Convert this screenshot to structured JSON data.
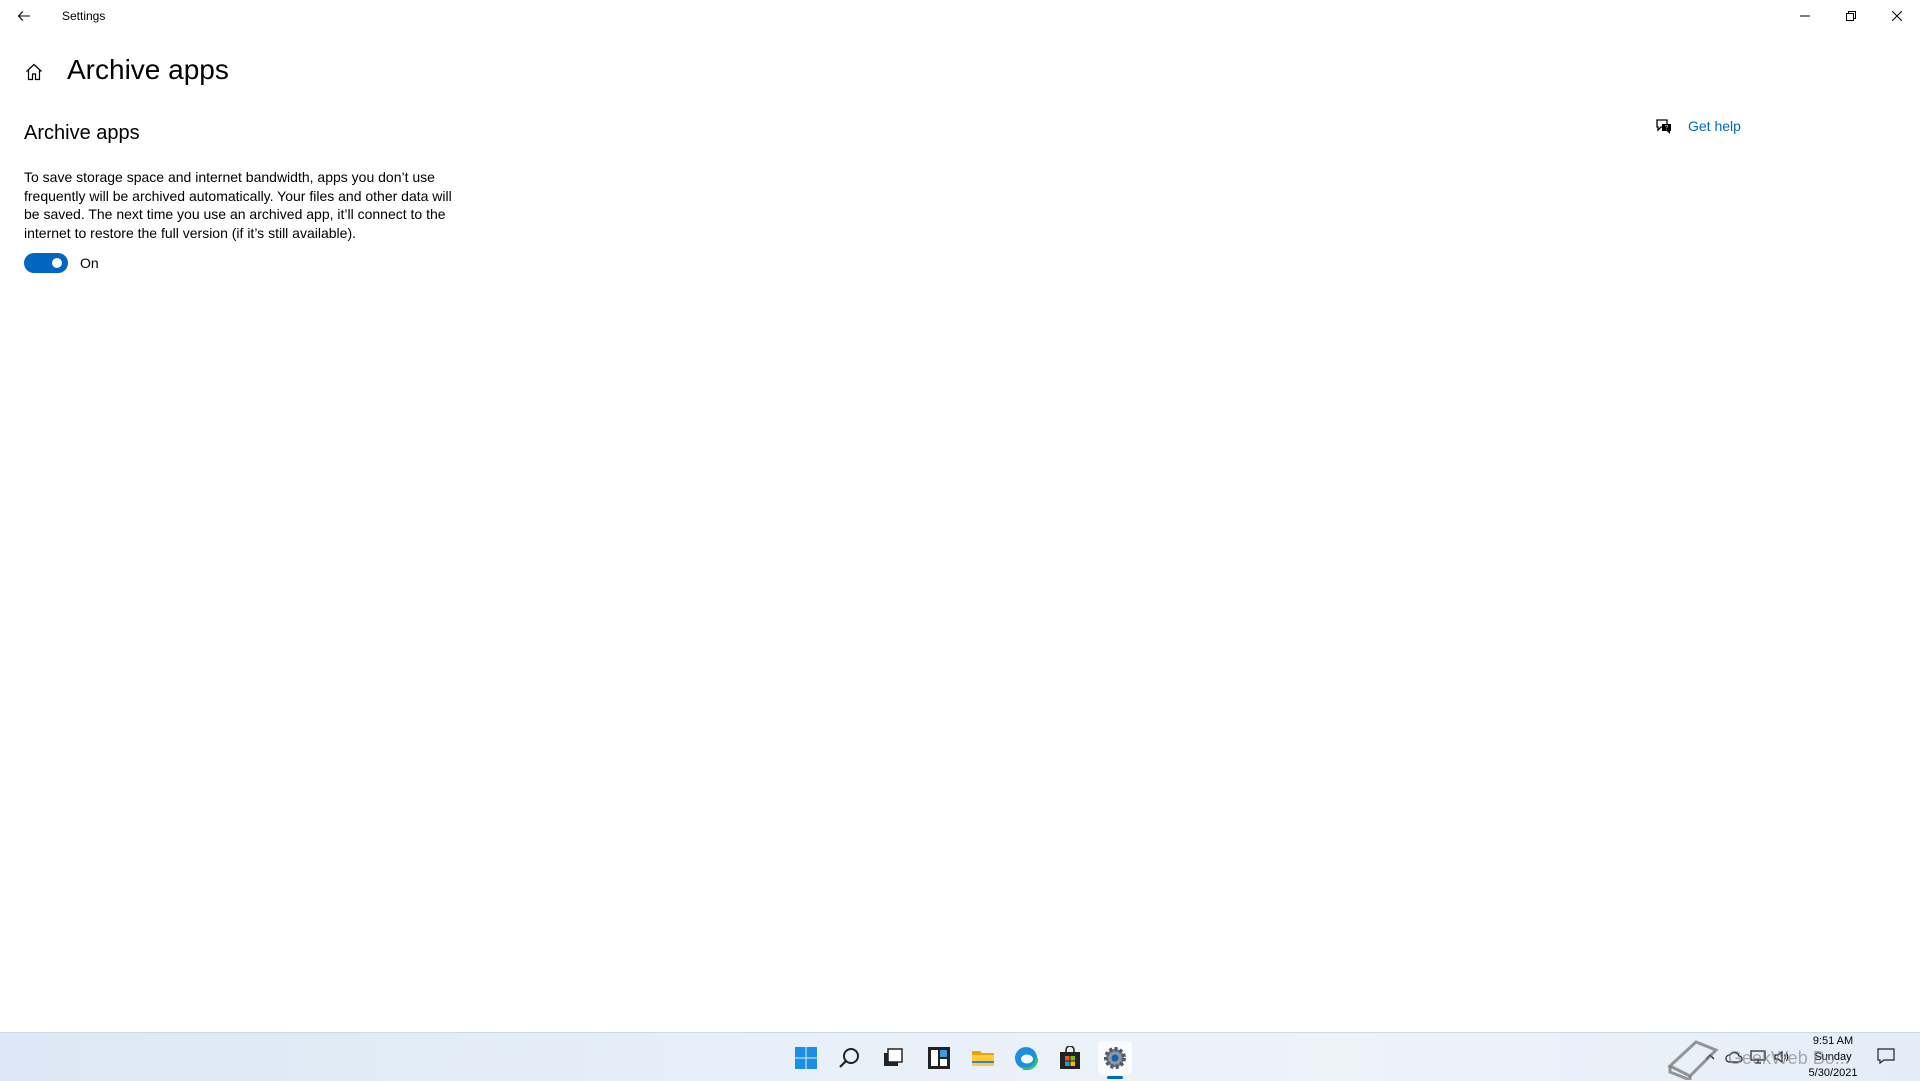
{
  "window": {
    "title": "Settings"
  },
  "header": {
    "page_title": "Archive apps"
  },
  "content": {
    "section_title": "Archive apps",
    "description": "To save storage space and internet bandwidth, apps you don’t use frequently will be archived automatically. Your files and other data will be saved. The next time you use an archived app, it’ll connect to the internet to restore the full version (if it’s still available).",
    "toggle": {
      "state": "on",
      "label": "On"
    }
  },
  "help": {
    "label": "Get help"
  },
  "taskbar": {
    "apps": [
      "start-icon",
      "search-icon",
      "task-view-icon",
      "widgets-icon",
      "file-explorer-icon",
      "edge-icon",
      "store-icon",
      "settings-icon"
    ],
    "active_app": "settings-icon"
  },
  "tray": {
    "time": "9:51 AM",
    "day": "Sunday",
    "date": "5/30/2021",
    "watermark": "GeekWeb Bo..."
  },
  "colors": {
    "accent": "#0067c0"
  }
}
